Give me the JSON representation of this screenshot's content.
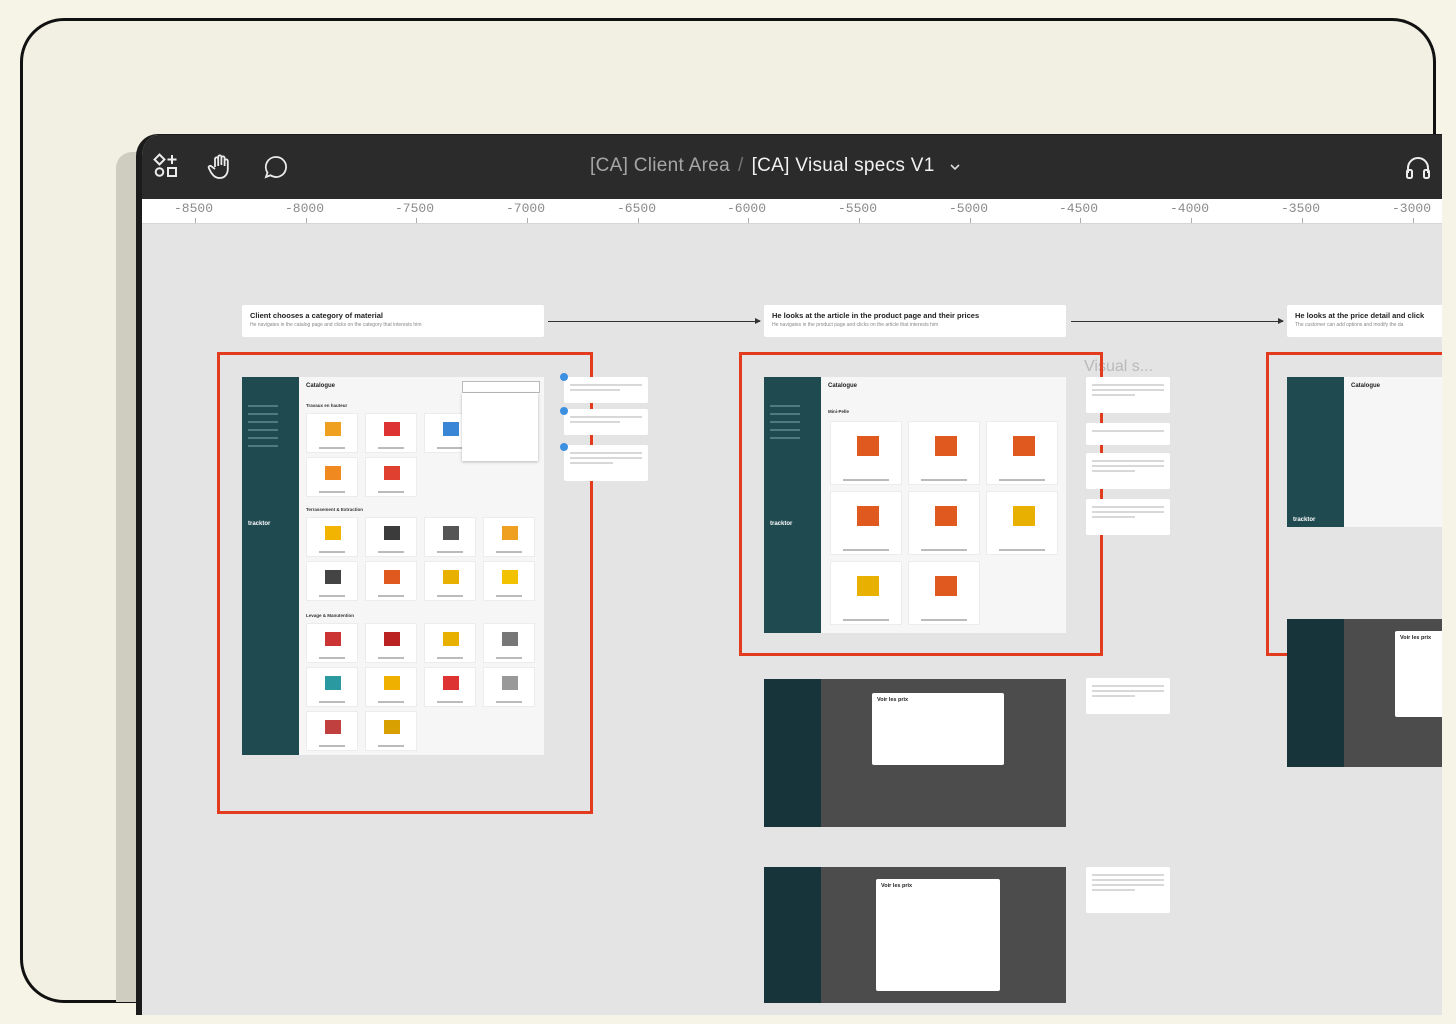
{
  "toolbar": {
    "title_parent": "[CA] Client Area",
    "title_separator": "/",
    "title_current": "[CA] Visual specs V1",
    "icons": [
      "assets-icon",
      "hand-icon",
      "comment-icon",
      "chevron-down-icon",
      "headset-icon"
    ]
  },
  "ruler": {
    "ticks": [
      "-8500",
      "-8000",
      "-7500",
      "-7000",
      "-6500",
      "-6000",
      "-5500",
      "-5000",
      "-4500",
      "-4000",
      "-3500",
      "-3000"
    ]
  },
  "flow": {
    "steps": [
      {
        "title": "Client chooses a category of material",
        "desc": "He navigates in the catalog page and clicks on the category that interests him"
      },
      {
        "title": "He looks at the article in the product page and their prices",
        "desc": "He navigates in the product page and clicks on the article that interests him"
      },
      {
        "title": "He looks at the price detail and click",
        "desc": "The customer can add options and modify the da"
      }
    ],
    "section_label": "Visual s..."
  },
  "mock": {
    "brand": "tracktor",
    "catalogue_title": "Catalogue",
    "sections": [
      "Travaux en hauteur",
      "Terrassement & Extraction",
      "Levage & Manutention"
    ],
    "product_title": "Mini-Pelle",
    "modal_title": "Voir les prix"
  },
  "colors": {
    "highlight": "#e23b1e",
    "sidebar": "#1f4a4f",
    "annotation": "#3d8fe0",
    "topbar": "#2b2b2b"
  }
}
